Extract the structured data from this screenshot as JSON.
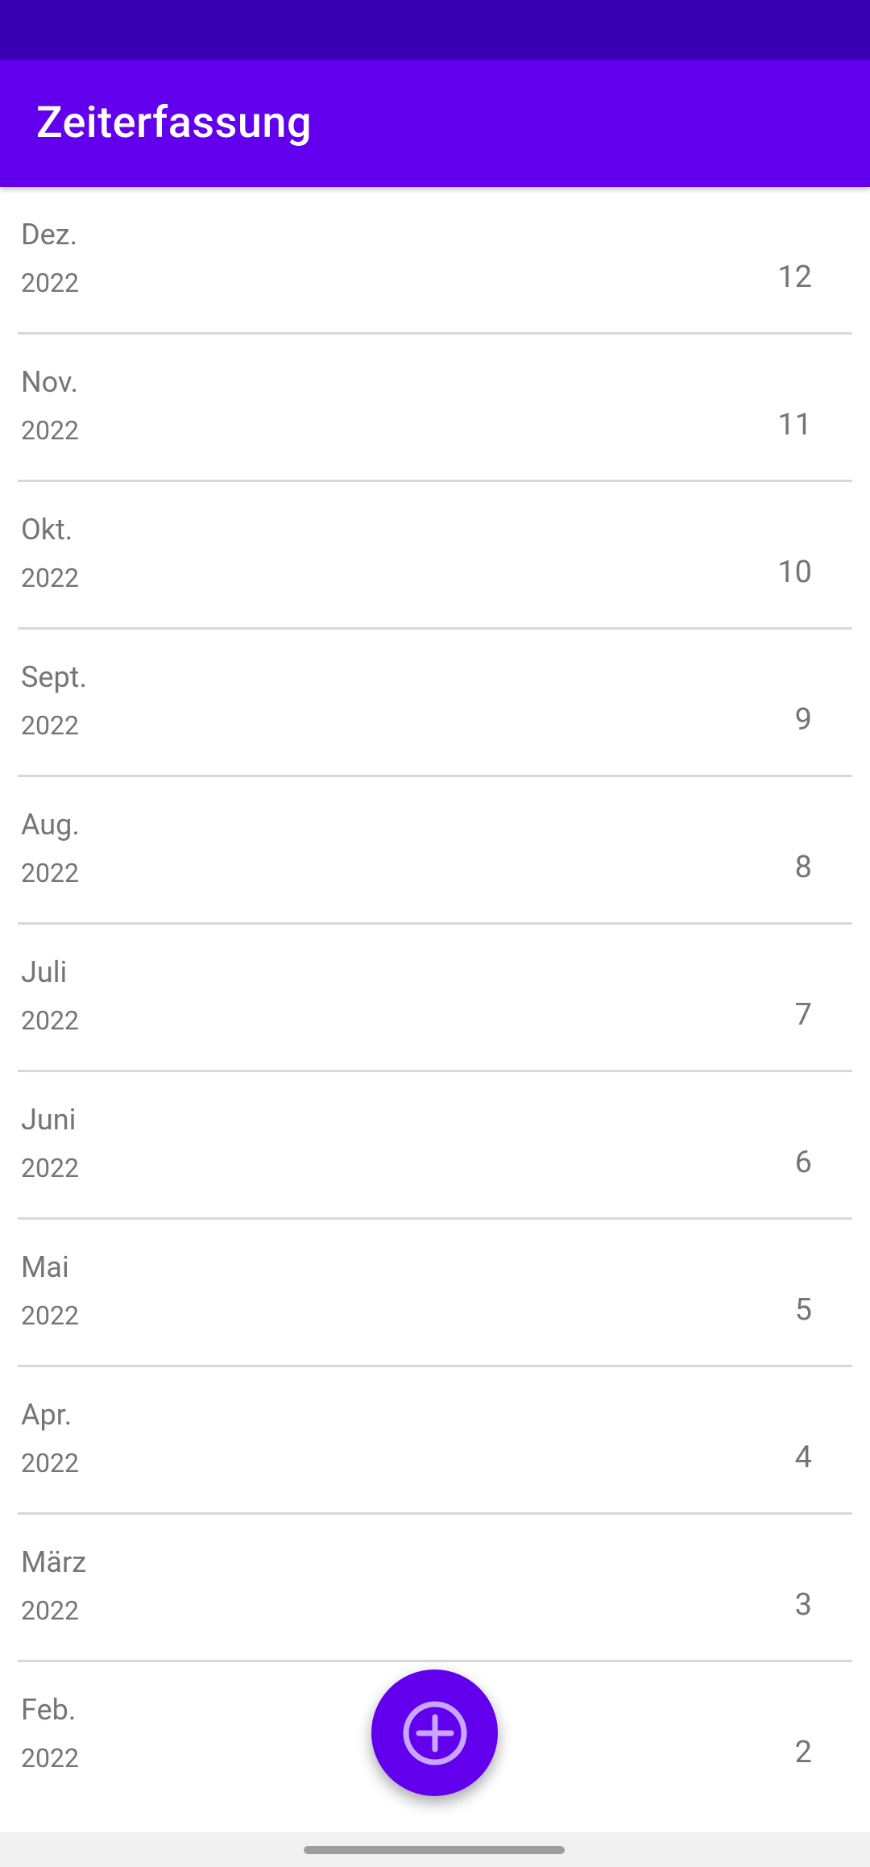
{
  "app": {
    "title": "Zeiterfassung",
    "colors": {
      "status_bar": "#3700b3",
      "primary": "#6200ee",
      "text_secondary": "#757575"
    }
  },
  "months": [
    {
      "month": "Dez.",
      "year": "2022",
      "number": "12"
    },
    {
      "month": "Nov.",
      "year": "2022",
      "number": "11"
    },
    {
      "month": "Okt.",
      "year": "2022",
      "number": "10"
    },
    {
      "month": "Sept.",
      "year": "2022",
      "number": "9"
    },
    {
      "month": "Aug.",
      "year": "2022",
      "number": "8"
    },
    {
      "month": "Juli",
      "year": "2022",
      "number": "7"
    },
    {
      "month": "Juni",
      "year": "2022",
      "number": "6"
    },
    {
      "month": "Mai",
      "year": "2022",
      "number": "5"
    },
    {
      "month": "Apr.",
      "year": "2022",
      "number": "4"
    },
    {
      "month": "März",
      "year": "2022",
      "number": "3"
    },
    {
      "month": "Feb.",
      "year": "2022",
      "number": "2"
    }
  ],
  "fab": {
    "icon": "add-circle-icon"
  }
}
